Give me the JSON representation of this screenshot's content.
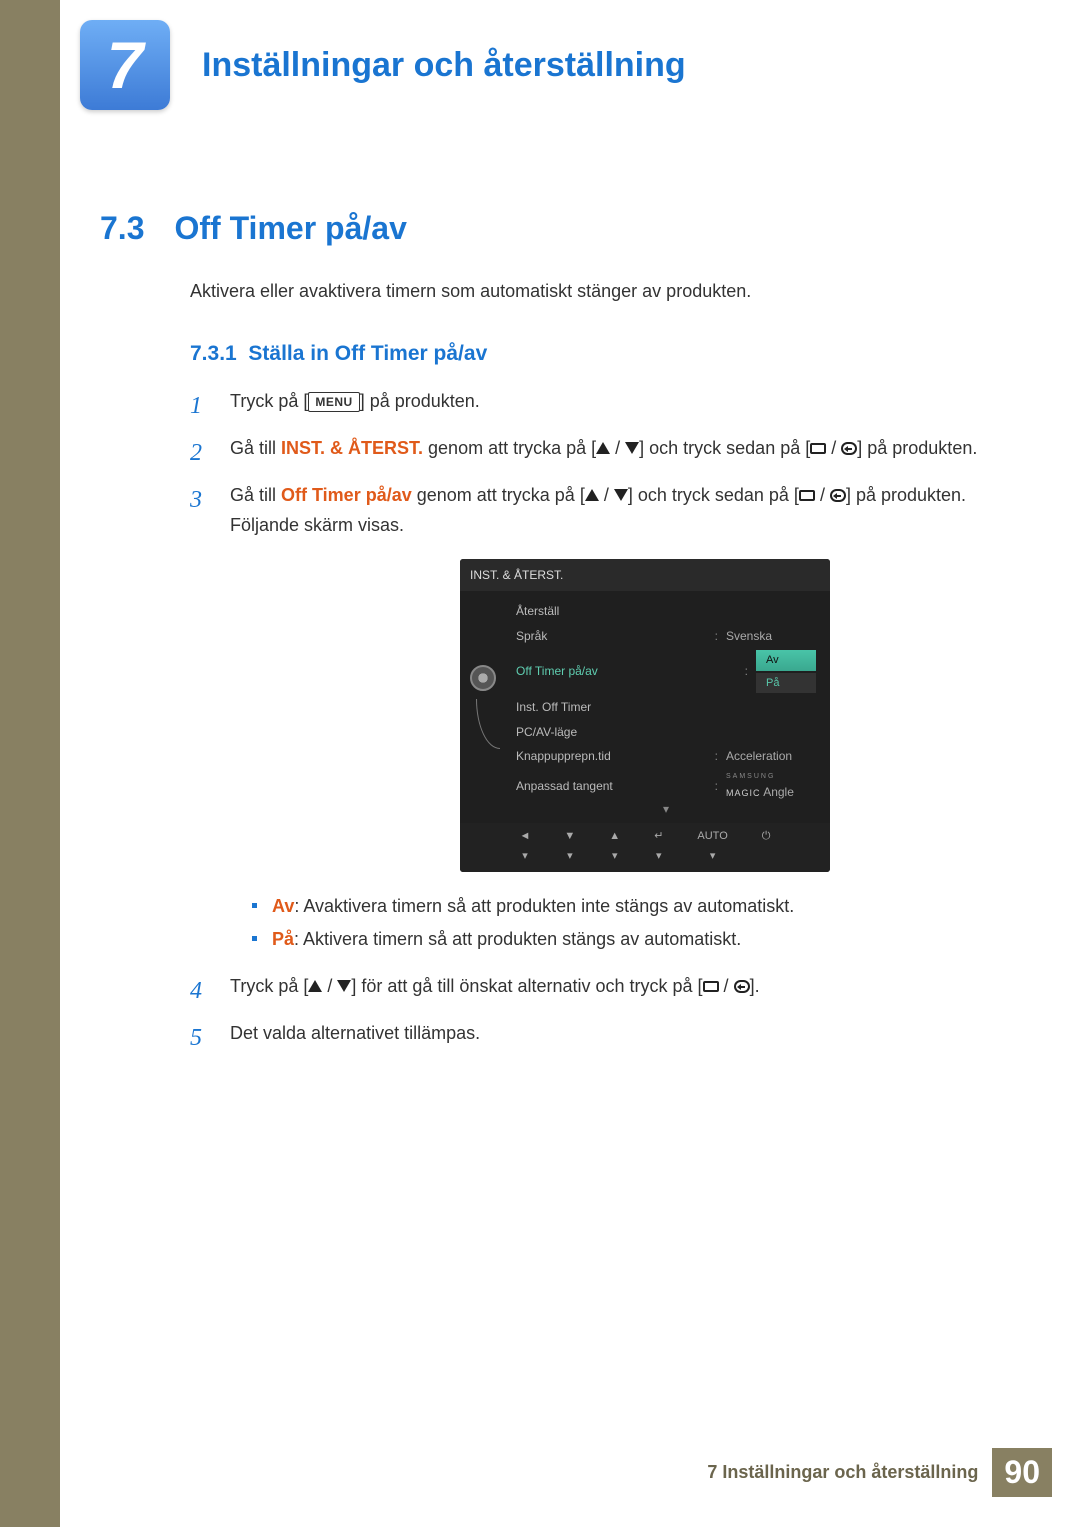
{
  "chapter": {
    "number": "7",
    "title": "Inställningar och återställning"
  },
  "section": {
    "number": "7.3",
    "title": "Off Timer på/av"
  },
  "intro": "Aktivera eller avaktivera timern som automatiskt stänger av produkten.",
  "subsection": {
    "number": "7.3.1",
    "title": "Ställa in Off Timer på/av"
  },
  "steps": {
    "s1": {
      "pre": "Tryck på [",
      "key": "MENU",
      "post": "] på produkten."
    },
    "s2": {
      "t1": "Gå till ",
      "highlight": "INST. & ÅTERST.",
      "t2": " genom att trycka på [",
      "t3": "] och tryck sedan på [",
      "t4": "] på produkten."
    },
    "s3": {
      "t1": "Gå till ",
      "highlight": "Off Timer på/av",
      "t2": " genom att trycka på [",
      "t3": "] och tryck sedan på [",
      "t4": "] på produkten.",
      "tail": "Följande skärm visas."
    },
    "s4": {
      "t1": "Tryck på [",
      "t2": "] för att gå till önskat alternativ och tryck på [",
      "t3": "]."
    },
    "s5": "Det valda alternativet tillämpas."
  },
  "bullets": {
    "av_label": "Av",
    "av_text": ": Avaktivera timern så att produkten inte stängs av automatiskt.",
    "pa_label": "På",
    "pa_text": ": Aktivera timern så att produkten stängs av automatiskt."
  },
  "osd": {
    "title": "INST. & ÅTERST.",
    "rows": {
      "r1": {
        "label": "Återställ"
      },
      "r2": {
        "label": "Språk",
        "value": "Svenska"
      },
      "r3": {
        "label": "Off Timer på/av",
        "chip1": "Av",
        "chip2": "På"
      },
      "r4": {
        "label": "Inst. Off Timer"
      },
      "r5": {
        "label": "PC/AV-läge"
      },
      "r6": {
        "label": "Knappupprepn.tid",
        "value": "Acceleration"
      },
      "r7": {
        "label": "Anpassad tangent",
        "brand": "SAMSUNG",
        "magic": "MAGIC",
        "suffix": " Angle"
      }
    },
    "footer": {
      "auto": "AUTO"
    }
  },
  "footer": {
    "text": "7 Inställningar och återställning",
    "page": "90"
  }
}
